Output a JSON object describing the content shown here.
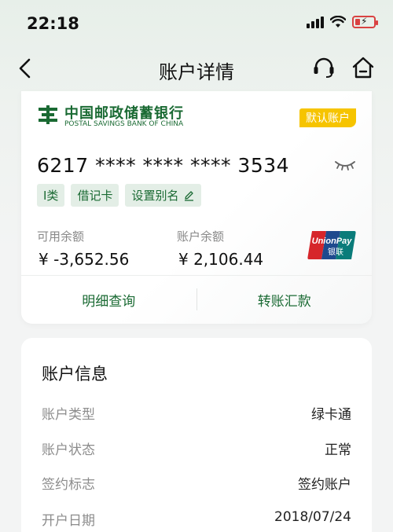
{
  "status_bar": {
    "time": "22:18"
  },
  "nav": {
    "title": "账户详情"
  },
  "card": {
    "bank_name_cn": "中国邮政储蓄银行",
    "bank_name_en": "POSTAL SAVINGS BANK OF CHINA",
    "default_badge": "默认账户",
    "card_number": "6217 **** **** **** 3534",
    "tags": [
      "I类",
      "借记卡",
      "设置别名"
    ],
    "available_label": "可用余额",
    "available_value": "¥ -3,652.56",
    "account_label": "账户余额",
    "account_value": "¥ 2,106.44",
    "unionpay_text_en": "UnionPay",
    "unionpay_text_cn": "银联",
    "actions": [
      "明细查询",
      "转账汇款"
    ]
  },
  "info": {
    "title": "账户信息",
    "rows": [
      {
        "label": "账户类型",
        "value": "绿卡通"
      },
      {
        "label": "账户状态",
        "value": "正常"
      },
      {
        "label": "签约标志",
        "value": "签约账户"
      },
      {
        "label": "开户日期",
        "value": "2018/07/24"
      }
    ]
  },
  "colors": {
    "brand_green": "#1a6a33",
    "badge_yellow": "#f6c400",
    "battery_red": "#d94242"
  }
}
